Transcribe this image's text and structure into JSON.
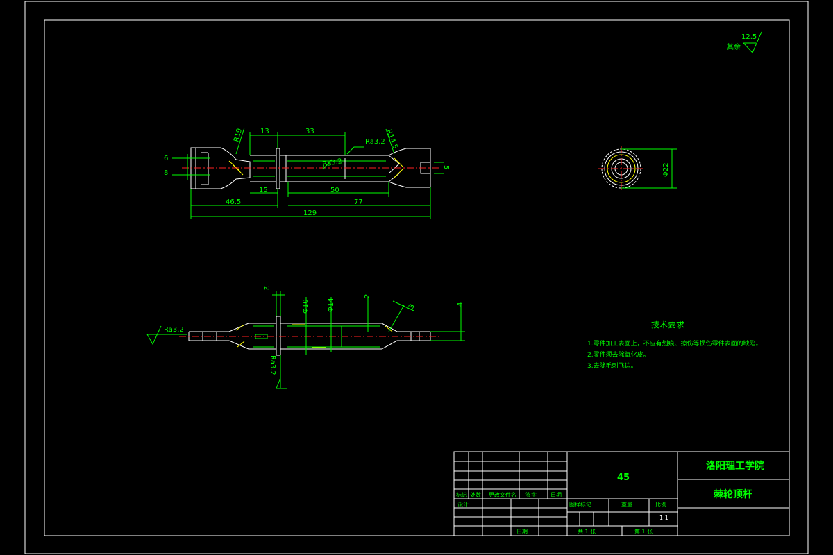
{
  "surface": {
    "label": "其余",
    "value": "12.5"
  },
  "dims_top": {
    "r19": "R19",
    "d13": "13",
    "d33": "33",
    "ra_top": "Ra3.2",
    "r145": "R14.5",
    "d6": "6",
    "d8": "8",
    "ra_mid": "Ra3.2",
    "d5": "5",
    "d15": "15",
    "d50": "50",
    "d465": "46.5",
    "d77": "77",
    "d129": "129"
  },
  "dims_side": {
    "dia": "Φ22"
  },
  "dims_bottom": {
    "ra_left": "Ra3.2",
    "d2": "2",
    "d10": "Φ10",
    "d14": "Φ14",
    "d2b": "2",
    "d3": "3",
    "d4": "4",
    "ra_bottom": "Ra3.2"
  },
  "tech": {
    "title": "技术要求",
    "items": [
      "1.零件加工表面上，不应有划痕、擦伤等损伤零件表面的缺陷。",
      "2.零件须去除氧化皮。",
      "3.去除毛刺飞边。"
    ]
  },
  "title_block": {
    "material": "45",
    "school": "洛阳理工学院",
    "part_name": "棘轮顶杆",
    "h_mark": "标记",
    "h_count": "处数",
    "h_doc": "更改文件名",
    "h_sign": "签字",
    "h_date": "日期",
    "h_design": "设计",
    "h_stage": "图样标记",
    "h_weight": "重量",
    "h_scale": "比例",
    "scale": "1:1",
    "date_label": "日期",
    "sheets_total": "共 1 张",
    "sheet_num": "第 1 张"
  }
}
